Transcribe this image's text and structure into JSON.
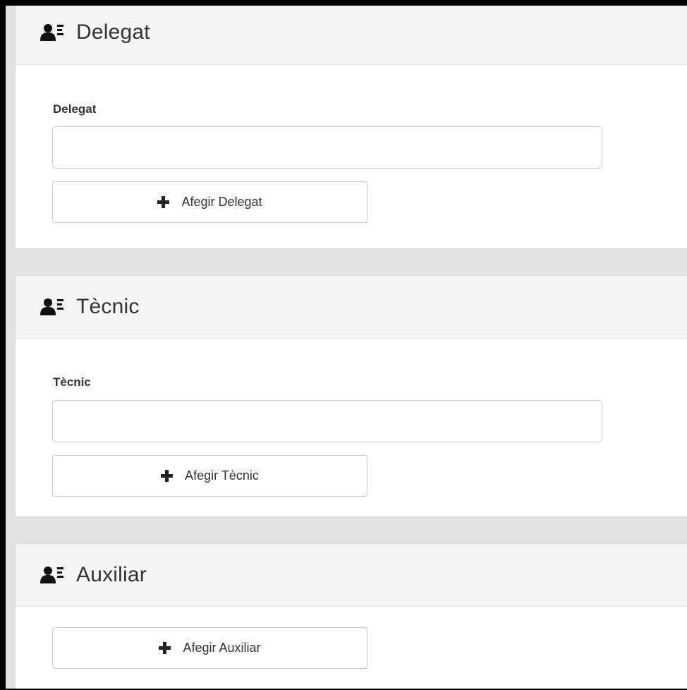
{
  "sections": [
    {
      "title": "Delegat",
      "icon": "user-list-icon",
      "field_label": "Delegat",
      "input_value": "",
      "button_label": "Afegir Delegat"
    },
    {
      "title": "Tècnic",
      "icon": "user-list-icon",
      "field_label": "Tècnic",
      "input_value": "",
      "button_label": "Afegir Tècnic"
    },
    {
      "title": "Auxiliar",
      "icon": "user-list-icon",
      "button_label": "Afegir Auxiliar"
    }
  ],
  "colors": {
    "heading_bg": "#f5f5f5",
    "page_bg": "#e2e2e2",
    "text": "#333333",
    "border": "#cccccc"
  }
}
